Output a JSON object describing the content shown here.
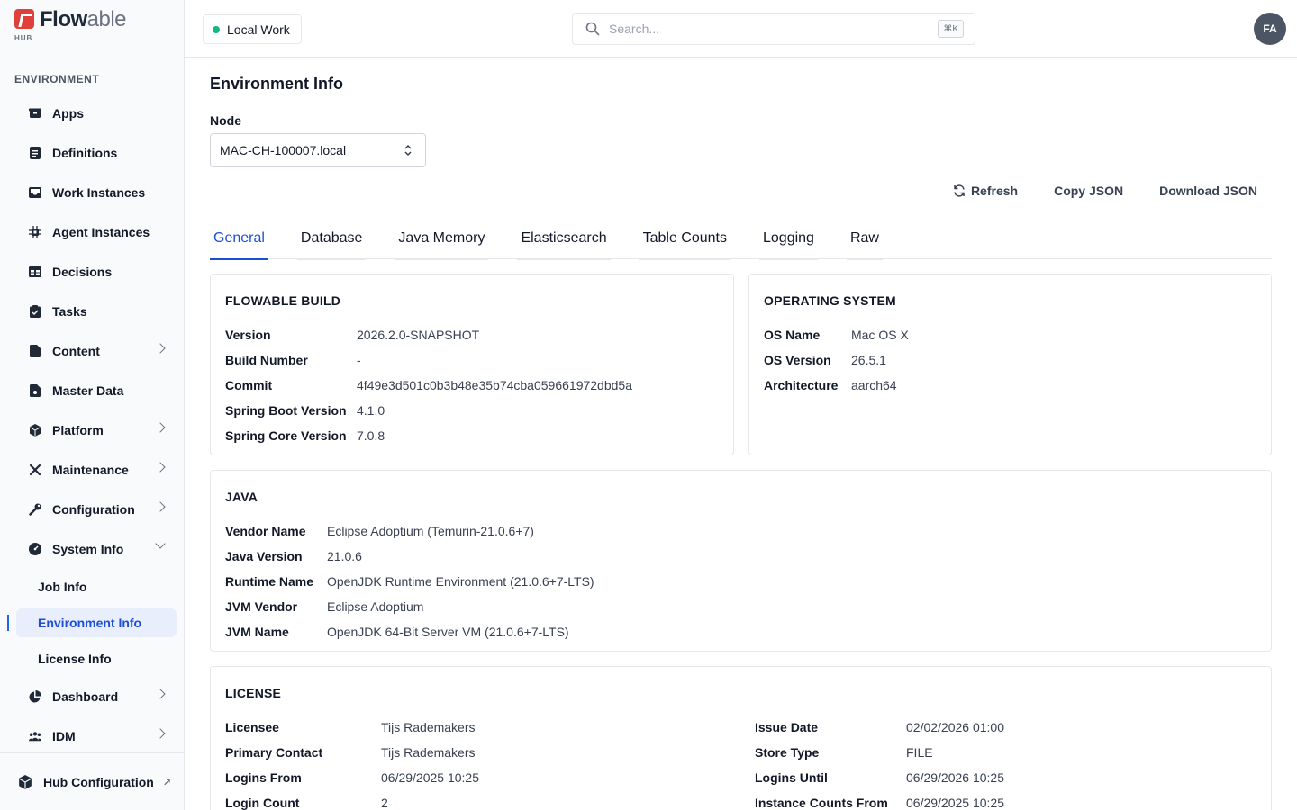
{
  "brand": {
    "name_bold": "Flow",
    "name_light": "able",
    "sub": "HUB"
  },
  "sidebar": {
    "section_label": "ENVIRONMENT",
    "items": [
      {
        "label": "Apps",
        "icon": "box-icon",
        "chevron": false
      },
      {
        "label": "Definitions",
        "icon": "document-icon",
        "chevron": false
      },
      {
        "label": "Work Instances",
        "icon": "inbox-icon",
        "chevron": false
      },
      {
        "label": "Agent Instances",
        "icon": "chip-icon",
        "chevron": false
      },
      {
        "label": "Decisions",
        "icon": "table-icon",
        "chevron": false
      },
      {
        "label": "Tasks",
        "icon": "clipboard-check-icon",
        "chevron": false
      },
      {
        "label": "Content",
        "icon": "file-icon",
        "chevron": true
      },
      {
        "label": "Master Data",
        "icon": "file-data-icon",
        "chevron": false
      },
      {
        "label": "Platform",
        "icon": "cube-icon",
        "chevron": true
      },
      {
        "label": "Maintenance",
        "icon": "tools-icon",
        "chevron": true
      },
      {
        "label": "Configuration",
        "icon": "wrench-icon",
        "chevron": true
      },
      {
        "label": "System Info",
        "icon": "gauge-icon",
        "chevron": true,
        "expanded": true
      }
    ],
    "sub_items": [
      {
        "label": "Job Info",
        "active": false
      },
      {
        "label": "Environment Info",
        "active": true
      },
      {
        "label": "License Info",
        "active": false
      }
    ],
    "items_after": [
      {
        "label": "Dashboard",
        "icon": "pie-chart-icon",
        "chevron": true
      },
      {
        "label": "IDM",
        "icon": "users-icon",
        "chevron": true
      }
    ],
    "bottom": {
      "label": "Hub Configuration",
      "icon": "cube-icon"
    }
  },
  "header": {
    "workspace": "Local Work",
    "search_placeholder": "Search...",
    "shortcut": "⌘K",
    "avatar_initials": "FA"
  },
  "page": {
    "title": "Environment Info",
    "node_label": "Node",
    "node_value": "MAC-CH-100007.local",
    "actions": {
      "refresh": "Refresh",
      "copy": "Copy JSON",
      "download": "Download JSON"
    },
    "tabs": [
      "General",
      "Database",
      "Java Memory",
      "Elasticsearch",
      "Table Counts",
      "Logging",
      "Raw"
    ],
    "active_tab": "General"
  },
  "cards": {
    "build": {
      "title": "FLOWABLE BUILD",
      "rows": [
        {
          "k": "Version",
          "v": "2026.2.0-SNAPSHOT"
        },
        {
          "k": "Build Number",
          "v": "-"
        },
        {
          "k": "Commit",
          "v": "4f49e3d501c0b3b48e35b74cba059661972dbd5a"
        },
        {
          "k": "Spring Boot Version",
          "v": "4.1.0"
        },
        {
          "k": "Spring Core Version",
          "v": "7.0.8"
        }
      ]
    },
    "os": {
      "title": "OPERATING SYSTEM",
      "rows": [
        {
          "k": "OS Name",
          "v": "Mac OS X"
        },
        {
          "k": "OS Version",
          "v": "26.5.1"
        },
        {
          "k": "Architecture",
          "v": "aarch64"
        }
      ]
    },
    "java": {
      "title": "JAVA",
      "rows": [
        {
          "k": "Vendor Name",
          "v": "Eclipse Adoptium (Temurin-21.0.6+7)"
        },
        {
          "k": "Java Version",
          "v": "21.0.6"
        },
        {
          "k": "Runtime Name",
          "v": "OpenJDK Runtime Environment (21.0.6+7-LTS)"
        },
        {
          "k": "JVM Vendor",
          "v": "Eclipse Adoptium"
        },
        {
          "k": "JVM Name",
          "v": "OpenJDK 64-Bit Server VM (21.0.6+7-LTS)"
        }
      ]
    },
    "license": {
      "title": "LICENSE",
      "left_rows": [
        {
          "k": "Licensee",
          "v": "Tijs Rademakers"
        },
        {
          "k": "Primary Contact",
          "v": "Tijs Rademakers"
        },
        {
          "k": "Logins From",
          "v": "06/29/2025 10:25"
        },
        {
          "k": "Login Count",
          "v": "2"
        }
      ],
      "right_rows": [
        {
          "k": "Issue Date",
          "v": "02/02/2026 01:00"
        },
        {
          "k": "Store Type",
          "v": "FILE"
        },
        {
          "k": "Logins Until",
          "v": "06/29/2026 10:25"
        },
        {
          "k": "Instance Counts From",
          "v": "06/29/2025 10:25"
        }
      ]
    }
  },
  "colors": {
    "accent": "#1d4ed8",
    "brand": "#e0403a",
    "status_dot": "#10b981"
  }
}
